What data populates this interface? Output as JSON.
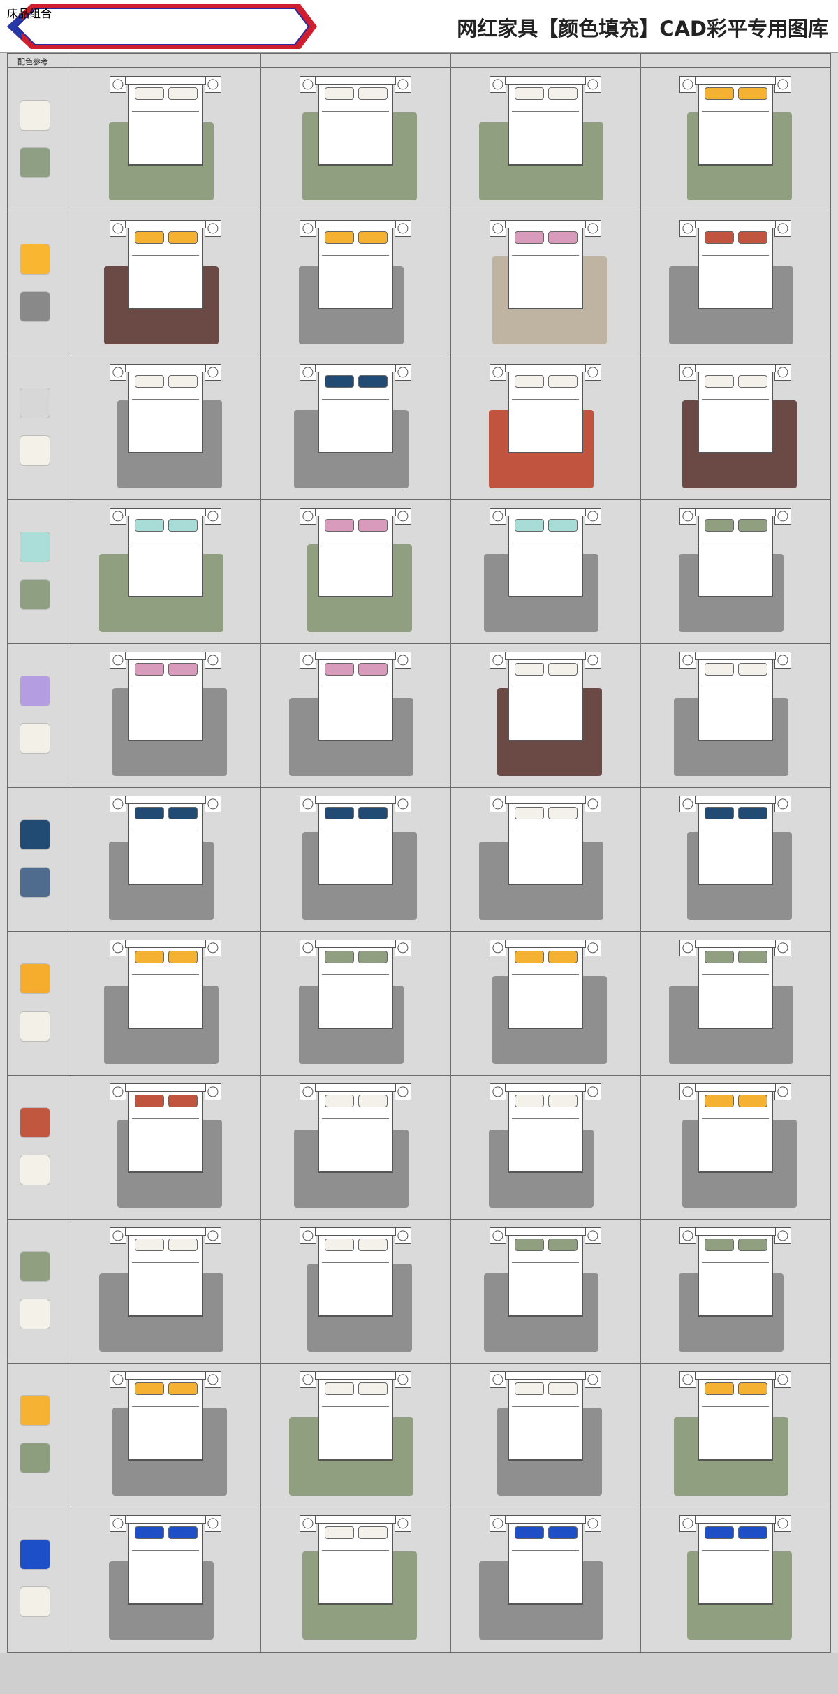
{
  "header": {
    "banner_title": "床品组合",
    "subtitle": "网红家具【颜色填充】CAD彩平专用图库"
  },
  "column_header": "配色参考",
  "colors": {
    "sage": "#8f9f80",
    "grey": "#8f8f8f",
    "mustard": "#f5b131",
    "brown": "#6b4a46",
    "terracotta": "#c1543f",
    "navy": "#214b73",
    "blue": "#1e4fc7",
    "cream": "#f3f1e9",
    "beige": "#bfb4a1",
    "mint": "#a8ddd7",
    "lavender_pink": "#d99bbb"
  },
  "swatches": [
    [
      "#f3f1e7",
      "#8e9f83"
    ],
    [
      "#f9b631",
      "#898989"
    ],
    [
      "#d7d7d7",
      "#f3f1e8"
    ],
    [
      "#abded8",
      "#8f9f82"
    ],
    [
      "#b49de0",
      "#f3f1e7"
    ],
    [
      "#214b73",
      "#4f6b8e"
    ],
    [
      "#f6ac2c",
      "#f3f1e7"
    ],
    [
      "#c1573f",
      "#f3f1e8"
    ],
    [
      "#8f9f80",
      "#f3f1e8"
    ],
    [
      "#f6b333",
      "#8d9e7f"
    ],
    [
      "#1d4fc8",
      "#f3f1e7"
    ]
  ],
  "grid": [
    [
      [
        "sage",
        "cream"
      ],
      [
        "sage",
        "cream"
      ],
      [
        "sage",
        "cream"
      ],
      [
        "sage",
        "mustard"
      ]
    ],
    [
      [
        "brown",
        "mustard"
      ],
      [
        "grey",
        "mustard"
      ],
      [
        "beige",
        "lavender_pink"
      ],
      [
        "grey",
        "terracotta"
      ]
    ],
    [
      [
        "grey",
        "cream"
      ],
      [
        "grey",
        "navy"
      ],
      [
        "terracotta",
        "cream"
      ],
      [
        "brown",
        "cream"
      ]
    ],
    [
      [
        "sage",
        "mint"
      ],
      [
        "sage",
        "lavender_pink"
      ],
      [
        "grey",
        "mint"
      ],
      [
        "grey",
        "sage"
      ]
    ],
    [
      [
        "grey",
        "lavender_pink"
      ],
      [
        "grey",
        "lavender_pink"
      ],
      [
        "brown",
        "cream"
      ],
      [
        "grey",
        "cream"
      ]
    ],
    [
      [
        "grey",
        "navy"
      ],
      [
        "grey",
        "navy"
      ],
      [
        "grey",
        "cream"
      ],
      [
        "grey",
        "navy"
      ]
    ],
    [
      [
        "grey",
        "mustard"
      ],
      [
        "grey",
        "sage"
      ],
      [
        "grey",
        "mustard"
      ],
      [
        "grey",
        "sage"
      ]
    ],
    [
      [
        "grey",
        "terracotta"
      ],
      [
        "grey",
        "cream"
      ],
      [
        "grey",
        "cream"
      ],
      [
        "grey",
        "mustard"
      ]
    ],
    [
      [
        "grey",
        "cream"
      ],
      [
        "grey",
        "cream"
      ],
      [
        "grey",
        "sage"
      ],
      [
        "grey",
        "sage"
      ]
    ],
    [
      [
        "grey",
        "mustard"
      ],
      [
        "sage",
        "cream"
      ],
      [
        "grey",
        "cream"
      ],
      [
        "sage",
        "mustard"
      ]
    ],
    [
      [
        "grey",
        "blue"
      ],
      [
        "sage",
        "cream"
      ],
      [
        "grey",
        "blue"
      ],
      [
        "sage",
        "blue"
      ]
    ]
  ]
}
